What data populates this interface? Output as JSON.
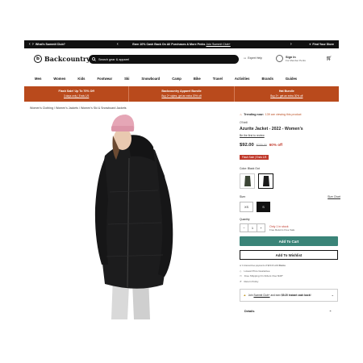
{
  "topbar": {
    "left": "What's Summit Club?",
    "center": "Earn 10% Cash Back On All Purchases & More Perks",
    "center_link": "Join Summit Club+",
    "right": "Find Your Store"
  },
  "header": {
    "logo_text": "Backcountry",
    "search_placeholder": "Search gear & apparel",
    "expert": "Expert Help",
    "signin_title": "Sign In",
    "signin_sub": "For Member Perks"
  },
  "nav": [
    "Men",
    "Women",
    "Kids",
    "Footwear",
    "Ski",
    "Snowboard",
    "Camp",
    "Bike",
    "Travel",
    "Activities",
    "Brands",
    "Guides"
  ],
  "promos": [
    {
      "title": "Flash Sale! Up To 70% Off",
      "sub": "3 days only | Ends 1/5"
    },
    {
      "title": "Backcountry Apparel Bundle",
      "sub": "Buy 2+ styles, get an extra 20% off"
    },
    {
      "title": "Hat Bundle",
      "sub": "Buy 3+, get an extra 30% off"
    }
  ],
  "breadcrumb": "Women's Clothing / Women's Jackets / Women's Ski & Snowboard Jackets",
  "product": {
    "trending": "Trending now:",
    "trending_rest": "139 are viewing this product",
    "brand": "O'Neill",
    "title": "Azurite Jacket - 2022 - Women's",
    "review": "Be the first to review",
    "price": "$92.00",
    "was": "$230.00",
    "off": "60% off",
    "flash": "Flash Sale | Ends 1/5",
    "color_label": "Color:",
    "color_value": "Black Out",
    "size_label": "Size:",
    "size_chart": "Size Chart",
    "sizes": [
      "XS",
      "S"
    ],
    "qty_label": "Quantity",
    "qty": "1",
    "stock": "Only 1 in stock",
    "stock_sub": "Free Returns Free Sale",
    "add_to_cart": "Add To Cart",
    "add_to_wishlist": "Add To Wishlist",
    "klarna": "or 4 interest-free payments of $23.00 with",
    "klarna_brand": "Klarna",
    "features": [
      "Lowest Price Guarantee",
      "Free Shipping On Orders Over $49*",
      "Return Policy"
    ],
    "summit_pre": "Join",
    "summit_link": "Summit Club+",
    "summit_mid": "and earn",
    "summit_bold": "$9.20 instant cash back!",
    "details": "Details"
  },
  "colors": {
    "accent": "#b94a1c",
    "cart_btn": "#3a8478",
    "sale": "#c0392b"
  }
}
